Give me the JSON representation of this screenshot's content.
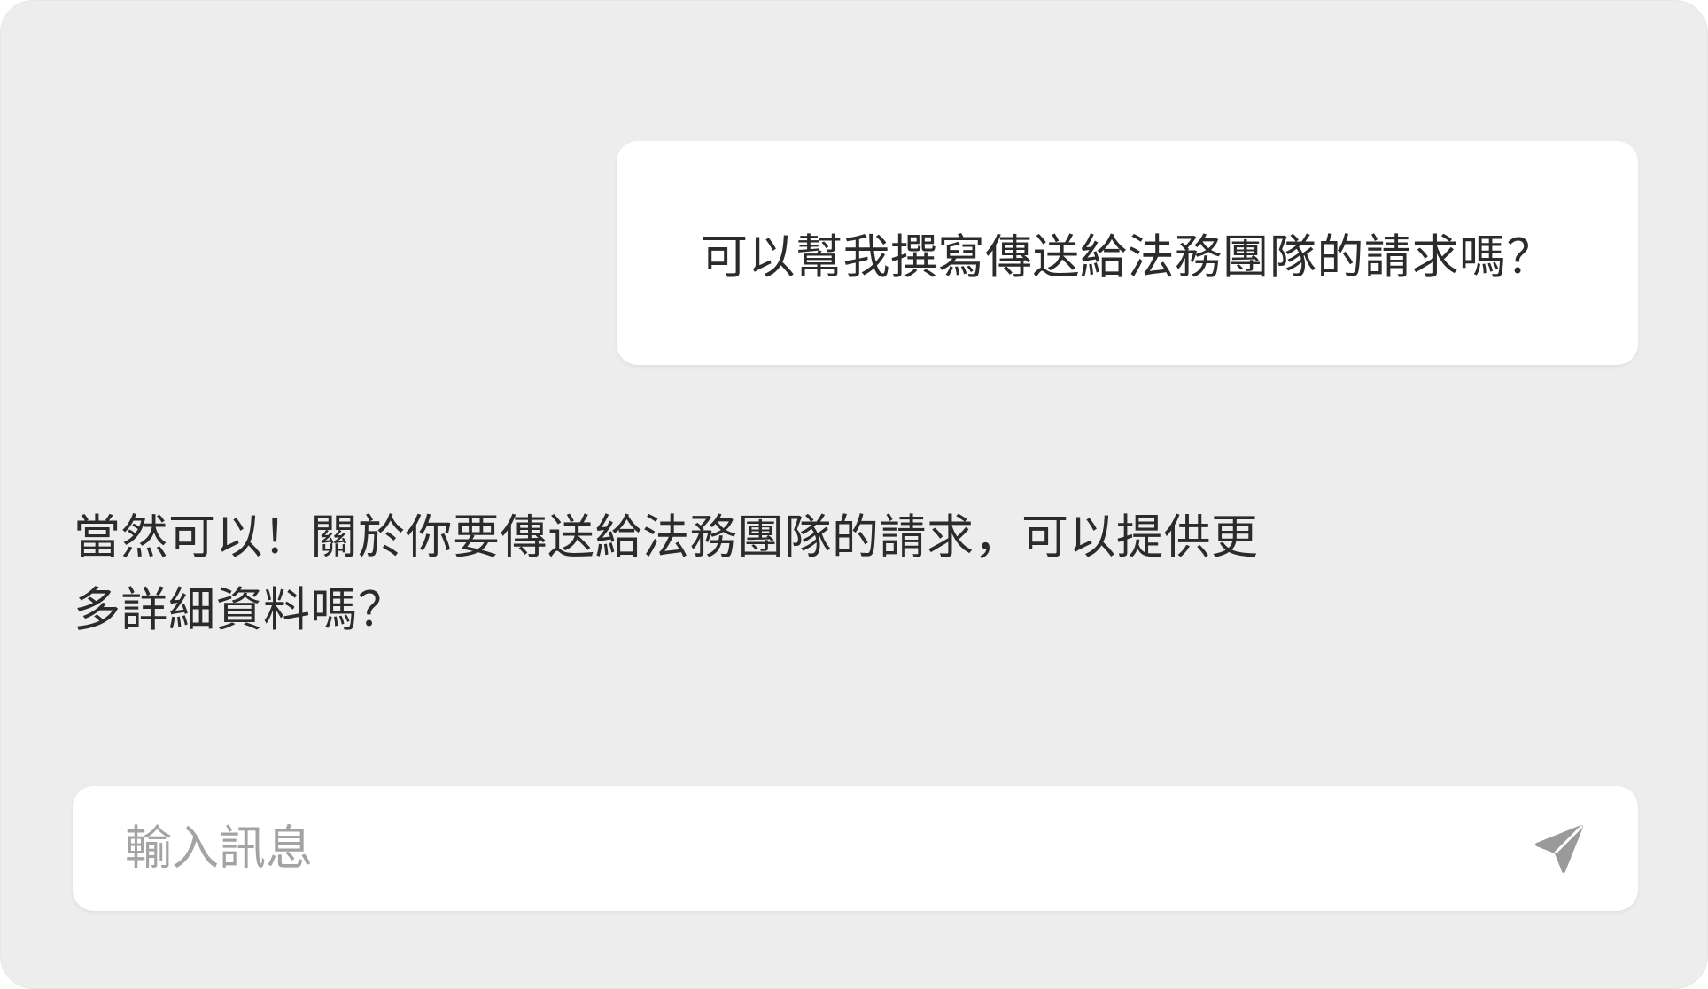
{
  "conversation": {
    "messages": [
      {
        "role": "user",
        "text": "可以幫我撰寫傳送給法務團隊的請求嗎？"
      },
      {
        "role": "assistant",
        "line1": "當然可以！關於你要傳送給法務團隊的請求，可以提供更",
        "line2": "多詳細資料嗎？"
      }
    ]
  },
  "composer": {
    "placeholder": "輸入訊息",
    "value": "",
    "send_icon": "send-icon"
  },
  "colors": {
    "panel_background": "#ededed",
    "bubble_background": "#ffffff",
    "text": "#2b2b2b",
    "placeholder_text": "#a3a3a3",
    "send_icon": "#9a9a9a"
  }
}
